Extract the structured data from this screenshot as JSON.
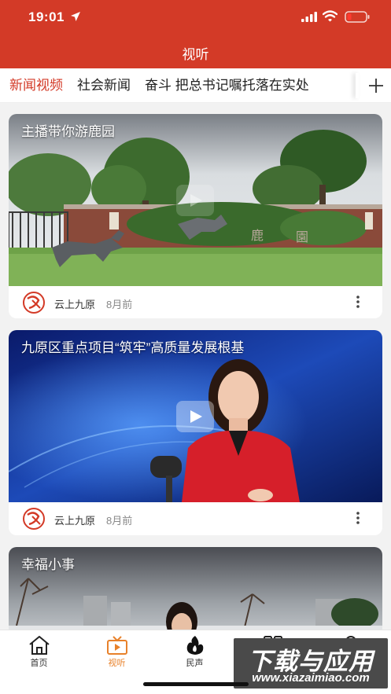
{
  "status_bar": {
    "time": "19:01"
  },
  "header": {
    "title": "视听"
  },
  "tabs": [
    {
      "label": "新闻视频",
      "active": true
    },
    {
      "label": "社会新闻",
      "active": false
    },
    {
      "label": "奋斗 把总书记嘱托落在实处",
      "active": false
    }
  ],
  "videos": [
    {
      "title": "主播带你游鹿园",
      "source": "云上九原",
      "time_ago": "8月前"
    },
    {
      "title": "九原区重点项目“筑牢”高质量发展根基",
      "source": "云上九原",
      "time_ago": "8月前"
    },
    {
      "title": "幸福小事"
    }
  ],
  "bottom_nav": [
    {
      "label": "首页",
      "icon": "home-icon"
    },
    {
      "label": "视听",
      "icon": "tv-icon",
      "active": true
    },
    {
      "label": "民声",
      "icon": "flame-icon"
    },
    {
      "label": "",
      "icon": "grid-icon"
    },
    {
      "label": "",
      "icon": "user-icon"
    }
  ],
  "watermark": {
    "title": "下载与应用",
    "url": "www.xiazaimiao.com"
  },
  "colors": {
    "brand_red": "#d33a27",
    "active_orange": "#e8812a"
  }
}
